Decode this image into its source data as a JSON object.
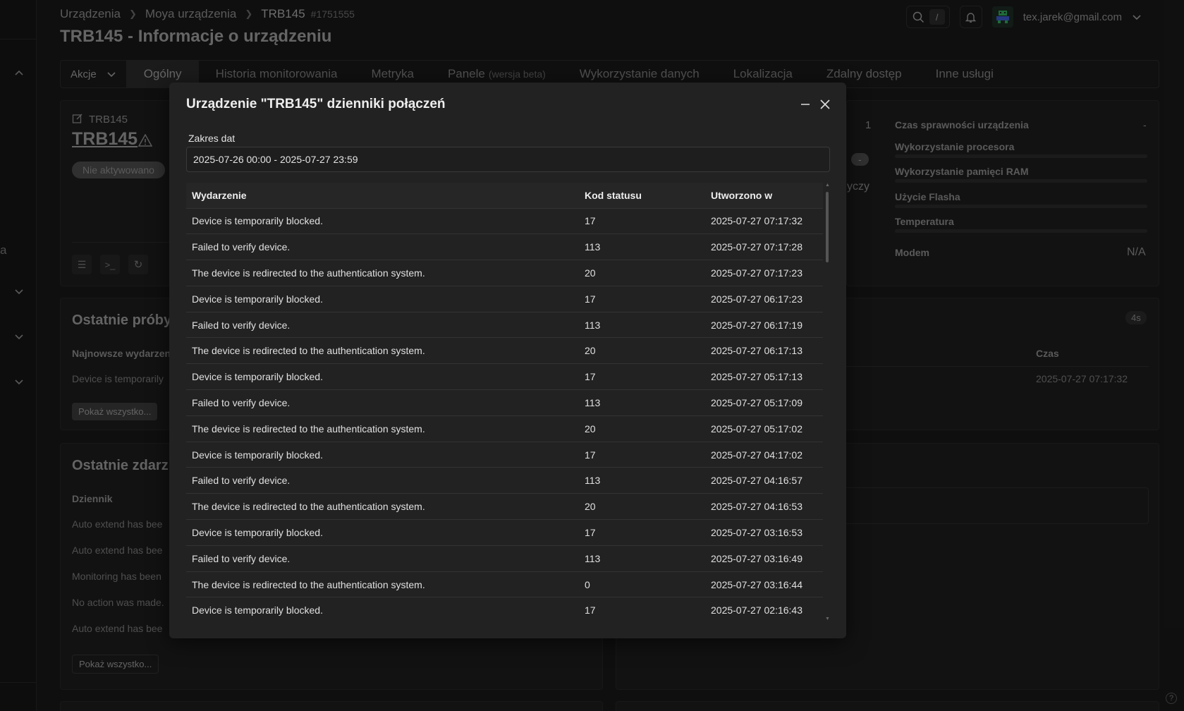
{
  "breadcrumb": {
    "items": [
      "Urządzenia",
      "Moya urządzenia",
      "TRB145"
    ],
    "device_id": "#1751555"
  },
  "page_title": "TRB145 - Informacje o urządzeniu",
  "topbar": {
    "search_shortcut": "/",
    "user_email": "tex.jarek@gmail.com"
  },
  "tabs": {
    "actions_label": "Akcje",
    "items": [
      {
        "label": "Ogólny"
      },
      {
        "label": "Historia monitorowania"
      },
      {
        "label": "Metryka"
      },
      {
        "label": "Panele",
        "suffix": "(wersja beta)"
      },
      {
        "label": "Wykorzystanie danych"
      },
      {
        "label": "Lokalizacja"
      },
      {
        "label": "Zdalny dostęp"
      },
      {
        "label": "Inne usługi"
      }
    ]
  },
  "device_card": {
    "small_name": "TRB145",
    "name": "TRB145",
    "status_badge": "Nie aktywowano"
  },
  "stats_card": {
    "uptime_label": "Czas sprawności urządzenia",
    "uptime_value": "-",
    "cpu_label": "Wykorzystanie procesora",
    "ram_label": "Wykorzystanie pamięci RAM",
    "flash_label": "Użycie Flasha",
    "temp_label": "Temperatura",
    "modem_label": "Modem",
    "modem_value": "N/A",
    "partial_count": "1",
    "partial_pill": "-",
    "partial_text": "yczy"
  },
  "recent_attempts": {
    "title": "Ostatnie próby",
    "col_label": "Najnowsze wydarzen",
    "row_text": "Device is temporarily",
    "show_all": "Pokaż wszystko..."
  },
  "recent_right": {
    "badge": "4s",
    "col_time": "Czas",
    "time_value": "2025-07-27 07:17:32"
  },
  "recent_events": {
    "title": "Ostatnie zdarz",
    "col_label": "Dziennik",
    "rows": [
      "Auto extend has bee",
      "Auto extend has bee",
      "Monitoring has been",
      "No action was made.",
      "Auto extend has bee"
    ],
    "show_all": "Pokaż wszystko..."
  },
  "left_rail": {
    "edge_text": "a"
  },
  "modal": {
    "title": "Urządzenie \"TRB145\" dzienniki połączeń",
    "date_label": "Zakres dat",
    "date_value": "2025-07-26 00:00 - 2025-07-27 23:59",
    "columns": {
      "event": "Wydarzenie",
      "status_code": "Kod statusu",
      "created_at": "Utworzono w"
    },
    "rows": [
      {
        "event": "Device is temporarily blocked.",
        "code": "17",
        "created": "2025-07-27 07:17:32"
      },
      {
        "event": "Failed to verify device.",
        "code": "113",
        "created": "2025-07-27 07:17:28"
      },
      {
        "event": "The device is redirected to the authentication system.",
        "code": "20",
        "created": "2025-07-27 07:17:23"
      },
      {
        "event": "Device is temporarily blocked.",
        "code": "17",
        "created": "2025-07-27 06:17:23"
      },
      {
        "event": "Failed to verify device.",
        "code": "113",
        "created": "2025-07-27 06:17:19"
      },
      {
        "event": "The device is redirected to the authentication system.",
        "code": "20",
        "created": "2025-07-27 06:17:13"
      },
      {
        "event": "Device is temporarily blocked.",
        "code": "17",
        "created": "2025-07-27 05:17:13"
      },
      {
        "event": "Failed to verify device.",
        "code": "113",
        "created": "2025-07-27 05:17:09"
      },
      {
        "event": "The device is redirected to the authentication system.",
        "code": "20",
        "created": "2025-07-27 05:17:02"
      },
      {
        "event": "Device is temporarily blocked.",
        "code": "17",
        "created": "2025-07-27 04:17:02"
      },
      {
        "event": "Failed to verify device.",
        "code": "113",
        "created": "2025-07-27 04:16:57"
      },
      {
        "event": "The device is redirected to the authentication system.",
        "code": "20",
        "created": "2025-07-27 04:16:53"
      },
      {
        "event": "Device is temporarily blocked.",
        "code": "17",
        "created": "2025-07-27 03:16:53"
      },
      {
        "event": "Failed to verify device.",
        "code": "113",
        "created": "2025-07-27 03:16:49"
      },
      {
        "event": "The device is redirected to the authentication system.",
        "code": "0",
        "created": "2025-07-27 03:16:44"
      },
      {
        "event": "Device is temporarily blocked.",
        "code": "17",
        "created": "2025-07-27 02:16:43"
      }
    ]
  }
}
